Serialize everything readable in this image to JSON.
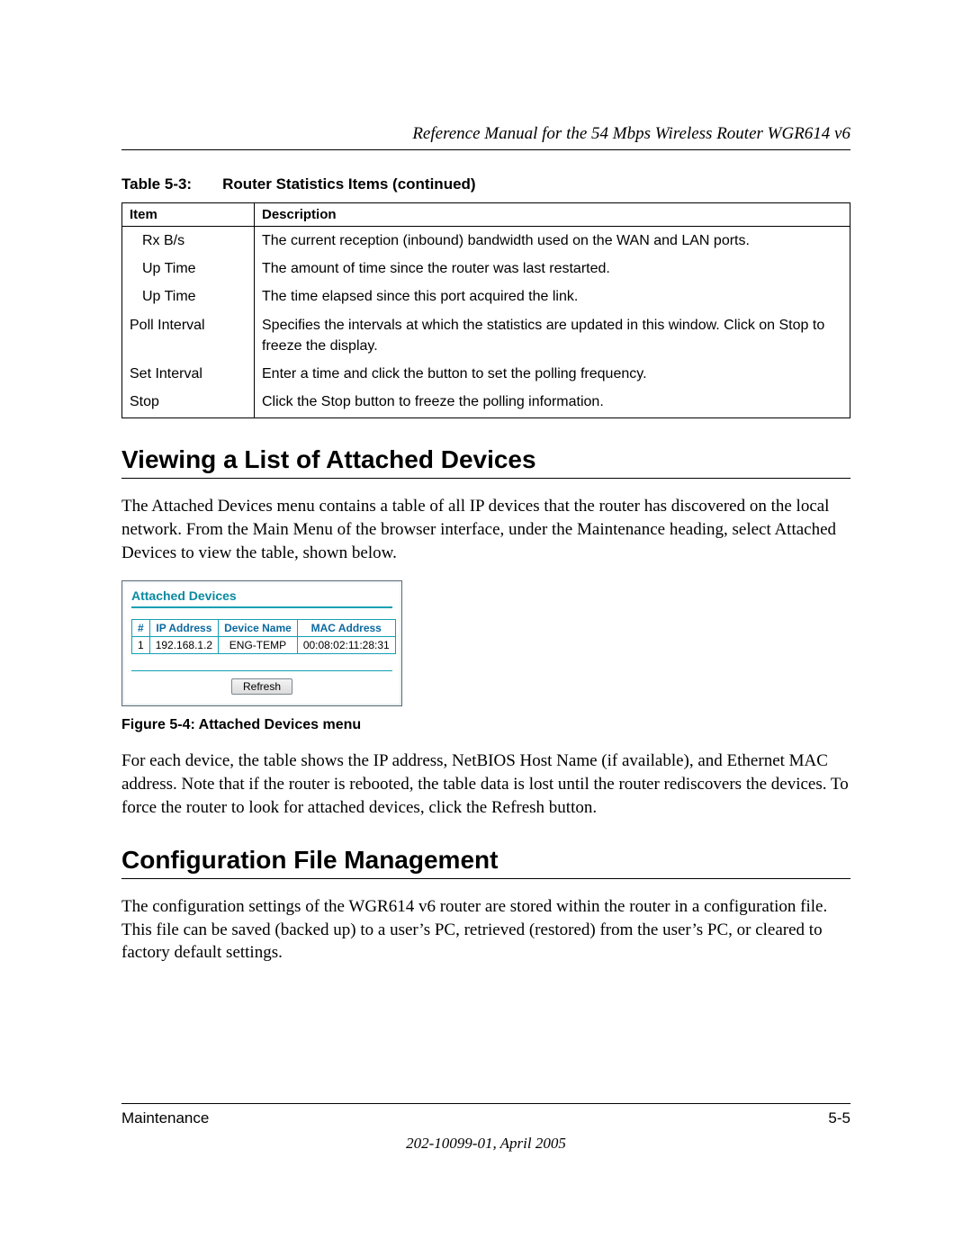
{
  "header": {
    "running": "Reference Manual for the 54 Mbps Wireless Router WGR614 v6"
  },
  "table": {
    "label": "Table 5-3:",
    "title": "Router Statistics Items  (continued)",
    "head_item": "Item",
    "head_desc": "Description",
    "rows": [
      {
        "item": "Rx B/s",
        "indent": true,
        "desc": "The current reception (inbound) bandwidth used on the WAN and LAN ports."
      },
      {
        "item": "Up Time",
        "indent": true,
        "desc": "The amount of time since the router was last restarted."
      },
      {
        "item": "Up Time",
        "indent": true,
        "desc": "The time elapsed since this port acquired the link."
      },
      {
        "item": "Poll Interval",
        "indent": false,
        "desc": "Specifies the intervals at which the statistics are updated in this window. Click on Stop to freeze the display."
      },
      {
        "item": "Set Interval",
        "indent": false,
        "desc": "Enter a time and click the button to set the polling frequency."
      },
      {
        "item": "Stop",
        "indent": false,
        "desc": "Click the Stop button to freeze the polling information."
      }
    ]
  },
  "section1": {
    "heading": "Viewing a List of Attached Devices",
    "para": "The Attached Devices menu contains a table of all IP devices that the router has discovered on the local network. From the Main Menu of the browser interface, under the Maintenance heading, select Attached Devices to view the table, shown below."
  },
  "panel": {
    "title": "Attached Devices",
    "head_num": "#",
    "head_ip": "IP Address",
    "head_name": "Device Name",
    "head_mac": "MAC Address",
    "row": {
      "num": "1",
      "ip": "192.168.1.2",
      "name": "ENG-TEMP",
      "mac": "00:08:02:11:28:31"
    },
    "refresh": "Refresh"
  },
  "figcaption": "Figure 5-4:  Attached Devices menu",
  "section1b": {
    "para": "For each device, the table shows the IP address, NetBIOS Host Name (if available), and Ethernet MAC address. Note that if the router is rebooted, the table data is lost until the router rediscovers the devices. To force the router to look for attached devices, click the Refresh button."
  },
  "section2": {
    "heading": "Configuration File Management",
    "para": "The configuration settings of the WGR614 v6 router are stored within the router in a configuration file. This file can be saved (backed up) to a user’s PC, retrieved (restored) from the user’s PC, or cleared to factory default settings."
  },
  "footer": {
    "left": "Maintenance",
    "right": "5-5",
    "docid": "202-10099-01, April 2005"
  }
}
